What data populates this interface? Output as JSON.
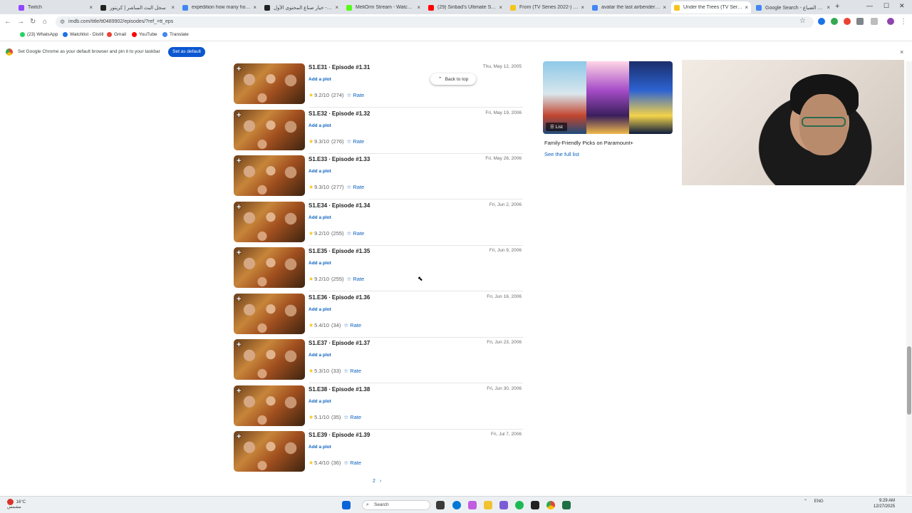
{
  "browser": {
    "tabs": [
      {
        "label": "Twitch",
        "color": "#9146ff",
        "active": false
      },
      {
        "label": "سجل البث المباشر | كريتور",
        "color": "#222222",
        "active": false
      },
      {
        "label": "expedition how many hours",
        "color": "#4285f4",
        "active": false
      },
      {
        "label": "كريتور - خيار صناع المحتوى الأول",
        "color": "#222222",
        "active": false
      },
      {
        "label": "MeliOrm Stream - Watch Live",
        "color": "#53fc18",
        "active": false
      },
      {
        "label": "(29) Sinbad's Ultimate Sacrifi...",
        "color": "#ff0000",
        "active": false
      },
      {
        "label": "From (TV Series 2022-) - Epi...",
        "color": "#f5c518",
        "active": false
      },
      {
        "label": "avatar the last airbender netf...",
        "color": "#4285f4",
        "active": false
      },
      {
        "label": "Under the Trees (TV Series 20...",
        "color": "#f5c518",
        "active": true
      },
      {
        "label": "Google Search - سنوات الضياع",
        "color": "#4285f4",
        "active": false
      }
    ],
    "new_tab": "+",
    "url": "imdb.com/title/tt0489902/episodes/?ref_=tt_eps",
    "bookmarks": [
      {
        "label": "(23) WhatsApp",
        "color": "#25d366"
      },
      {
        "label": "Watchlist - Distill",
        "color": "#1a73e8"
      },
      {
        "label": "Gmail",
        "color": "#ea4335"
      },
      {
        "label": "YouTube",
        "color": "#ff0000"
      },
      {
        "label": "Translate",
        "color": "#4285f4"
      }
    ],
    "infobar": {
      "message": "Set Google Chrome as your default browser and pin it to your taskbar",
      "button": "Set as default",
      "close": "×"
    }
  },
  "page": {
    "back_to_top": "Back to top",
    "episodes": [
      {
        "title": "S1.E31 ∙ Episode #1.31",
        "date": "Thu, May 12, 2005",
        "add_plot": "Add a plot",
        "rating": "9.2/10",
        "votes": "(274)",
        "rate": "Rate"
      },
      {
        "title": "S1.E32 ∙ Episode #1.32",
        "date": "Fri, May 19, 2006",
        "add_plot": "Add a plot",
        "rating": "9.3/10",
        "votes": "(276)",
        "rate": "Rate"
      },
      {
        "title": "S1.E33 ∙ Episode #1.33",
        "date": "Fri, May 26, 2006",
        "add_plot": "Add a plot",
        "rating": "9.3/10",
        "votes": "(277)",
        "rate": "Rate"
      },
      {
        "title": "S1.E34 ∙ Episode #1.34",
        "date": "Fri, Jun 2, 2006",
        "add_plot": "Add a plot",
        "rating": "9.2/10",
        "votes": "(255)",
        "rate": "Rate"
      },
      {
        "title": "S1.E35 ∙ Episode #1.35",
        "date": "Fri, Jun 9, 2006",
        "add_plot": "Add a plot",
        "rating": "9.2/10",
        "votes": "(255)",
        "rate": "Rate"
      },
      {
        "title": "S1.E36 ∙ Episode #1.36",
        "date": "Fri, Jun 16, 2006",
        "add_plot": "Add a plot",
        "rating": "5.4/10",
        "votes": "(34)",
        "rate": "Rate"
      },
      {
        "title": "S1.E37 ∙ Episode #1.37",
        "date": "Fri, Jun 23, 2006",
        "add_plot": "Add a plot",
        "rating": "5.3/10",
        "votes": "(33)",
        "rate": "Rate"
      },
      {
        "title": "S1.E38 ∙ Episode #1.38",
        "date": "Fri, Jun 30, 2006",
        "add_plot": "Add a plot",
        "rating": "5.1/10",
        "votes": "(35)",
        "rate": "Rate"
      },
      {
        "title": "S1.E39 ∙ Episode #1.39",
        "date": "Fri, Jul 7, 2006",
        "add_plot": "Add a plot",
        "rating": "5.4/10",
        "votes": "(36)",
        "rate": "Rate"
      }
    ],
    "pagination": {
      "page": "2",
      "next": "›"
    },
    "sidebar_list": {
      "chip": "List",
      "title": "Family-Friendly Picks on Paramount+",
      "link": "See the full list"
    }
  },
  "taskbar": {
    "weather": {
      "temp": "16°C",
      "condition": "مشمس"
    },
    "search_placeholder": "Search",
    "clock": {
      "time": "9:29 AM",
      "date": "12/27/2025"
    },
    "tray_lang": "ENG"
  }
}
